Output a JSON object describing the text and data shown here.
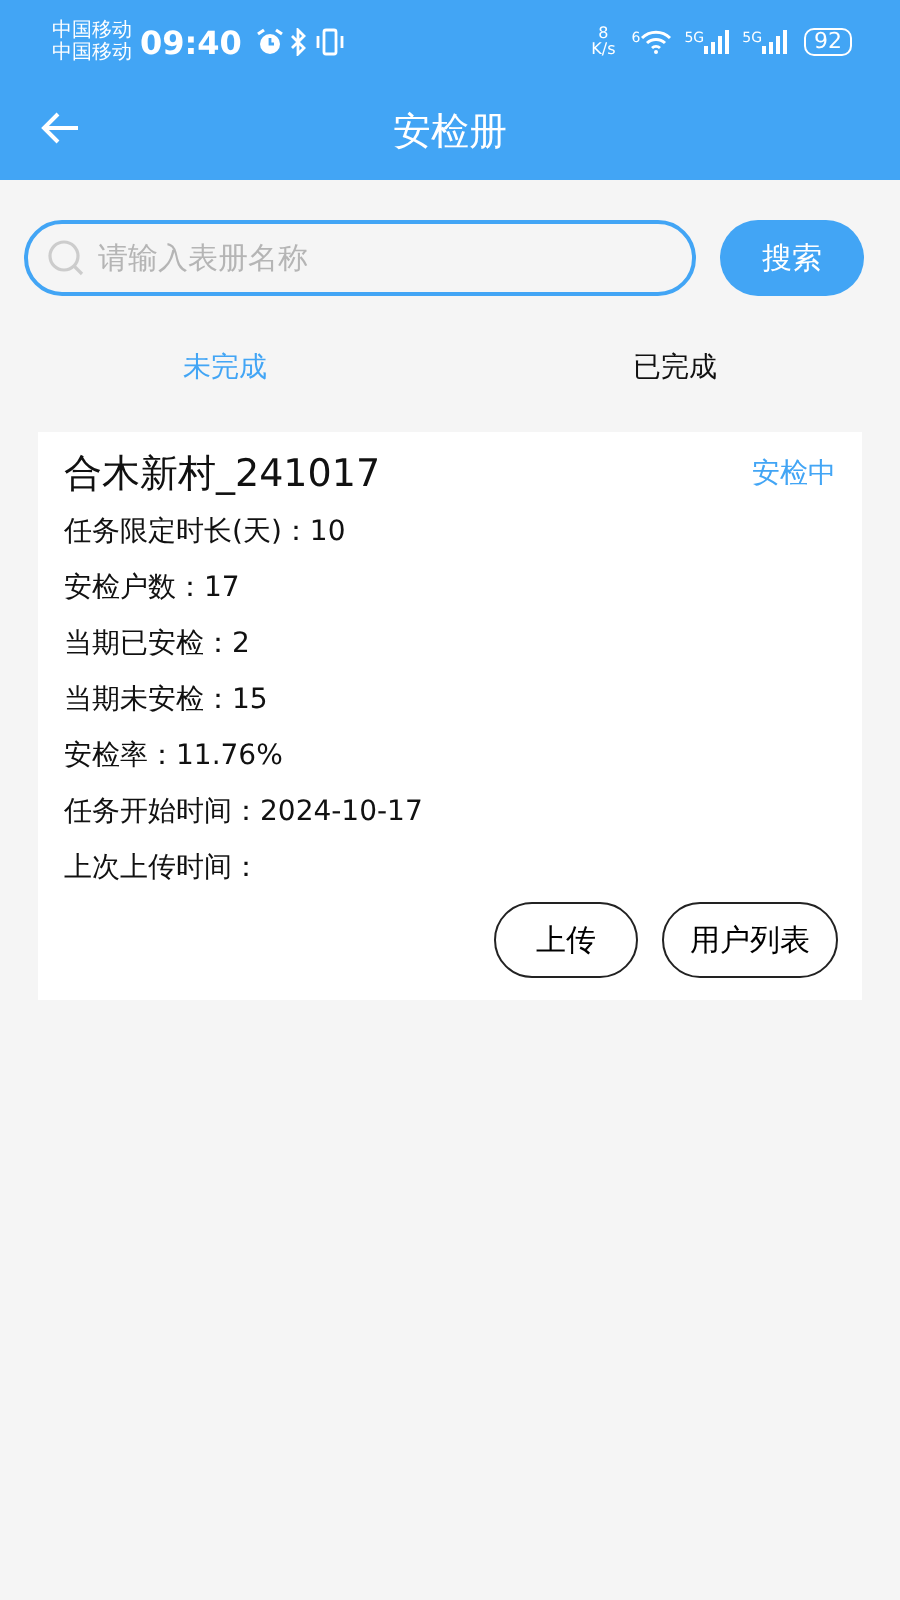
{
  "status_bar": {
    "carriers": [
      "中国移动",
      "中国移动"
    ],
    "time": "09:40",
    "speed_value": "8",
    "speed_unit": "K/s",
    "wifi_badge": "6",
    "networks": [
      "5G",
      "5G"
    ],
    "battery": "92"
  },
  "header": {
    "title": "安检册"
  },
  "search": {
    "placeholder": "请输入表册名称",
    "button": "搜索"
  },
  "tabs": [
    {
      "label": "未完成",
      "selected": true
    },
    {
      "label": "已完成",
      "selected": false
    }
  ],
  "cards": [
    {
      "title": "合木新村_241017",
      "status": "安检中",
      "fields": [
        "任务限定时长(天)：10",
        "安检户数：17",
        "当期已安检：2",
        "当期未安检：15",
        "安检率：11.76%",
        "任务开始时间：2024-10-17",
        "上次上传时间："
      ],
      "buttons": [
        "上传",
        "用户列表"
      ]
    }
  ]
}
